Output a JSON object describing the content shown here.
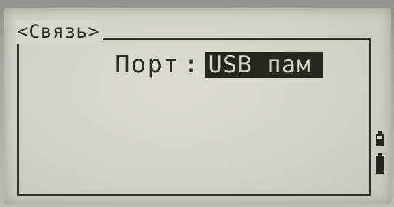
{
  "screen": {
    "title": "<Связь>"
  },
  "port": {
    "label": "Порт",
    "separator": ":",
    "value": "USB пам"
  },
  "status": {
    "icons": [
      "battery-icon",
      "battery-icon"
    ]
  }
}
